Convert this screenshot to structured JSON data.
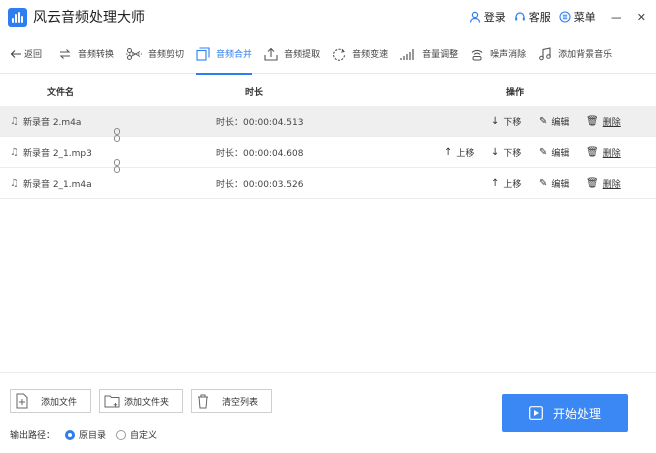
{
  "app": {
    "title": "风云音频处理大师"
  },
  "titlebar": {
    "login": "登录",
    "service": "客服",
    "menu": "菜单",
    "minimize": "－",
    "close": "✕"
  },
  "toolbar": {
    "back": "返回",
    "items": [
      {
        "label": "音频转换",
        "icon": "convert-icon"
      },
      {
        "label": "音频剪切",
        "icon": "scissors-icon"
      },
      {
        "label": "音频合并",
        "icon": "merge-icon",
        "active": true
      },
      {
        "label": "音频提取",
        "icon": "extract-icon"
      },
      {
        "label": "音频变速",
        "icon": "speed-icon"
      },
      {
        "label": "音量调整",
        "icon": "volume-icon"
      },
      {
        "label": "噪声消除",
        "icon": "denoise-icon"
      },
      {
        "label": "添加背景音乐",
        "icon": "bgm-icon"
      }
    ]
  },
  "table": {
    "headers": {
      "name": "文件名",
      "duration": "时长",
      "ops": "操作"
    },
    "rows": [
      {
        "name": "新录音 2.m4a",
        "duration": "时长：00:00:04.513"
      },
      {
        "name": "新录音 2_1.mp3",
        "duration": "时长：00:00:04.608"
      },
      {
        "name": "新录音 2_1.m4a",
        "duration": "时长：00:00:03.526"
      }
    ],
    "ops": {
      "up": "上移",
      "down": "下移",
      "edit": "编辑",
      "delete": "删除"
    }
  },
  "footer": {
    "add_file": "添加文件",
    "add_folder": "添加文件夹",
    "clear_list": "清空列表",
    "output_label": "输出路径：",
    "opt_original": "原目录",
    "opt_custom": "自定义",
    "start": "开始处理"
  },
  "colors": {
    "accent": "#2f7ef1",
    "start_button": "#3b87f3"
  }
}
